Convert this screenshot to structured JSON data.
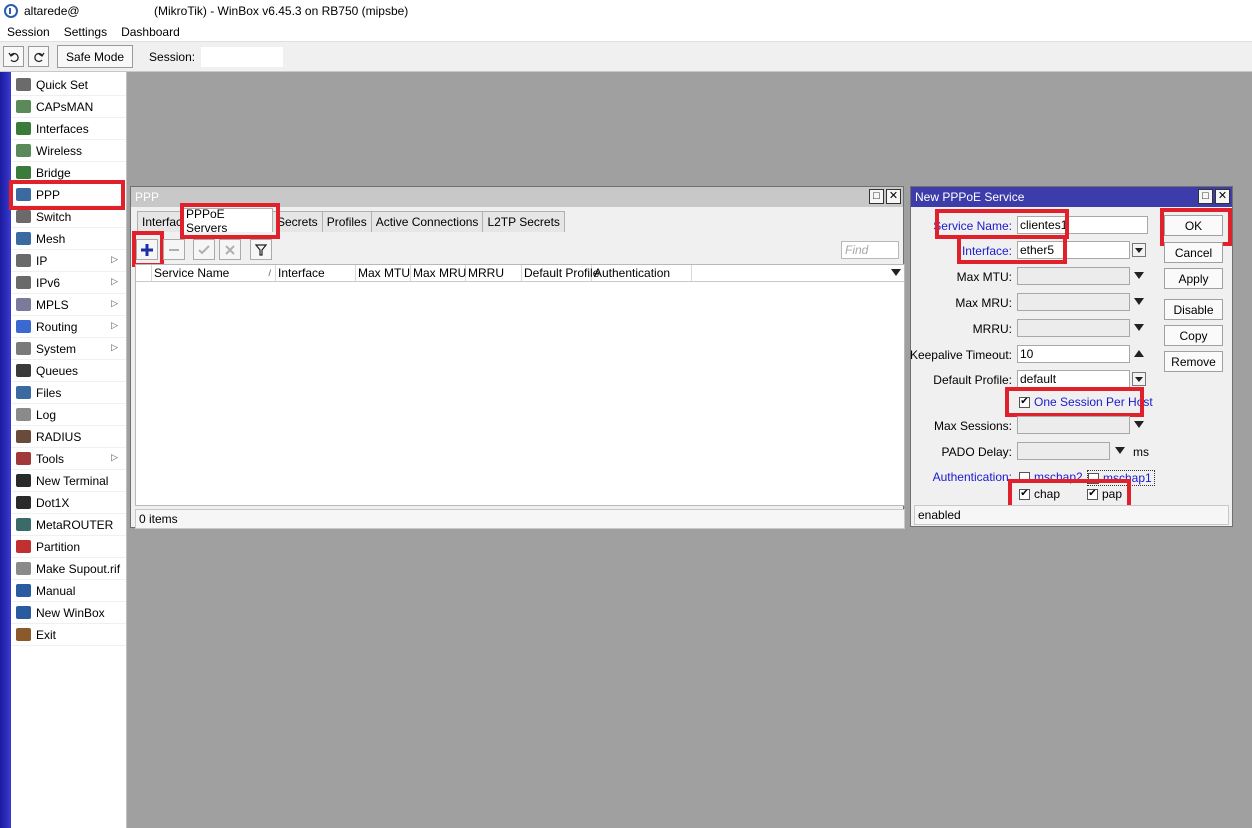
{
  "window": {
    "user": "altarede@",
    "title": "(MikroTik) - WinBox v6.45.3 on RB750 (mipsbe)"
  },
  "menubar": [
    "Session",
    "Settings",
    "Dashboard"
  ],
  "toolbar": {
    "undo_icon": "undo-icon",
    "redo_icon": "redo-icon",
    "safe_mode": "Safe Mode",
    "session_label": "Session:"
  },
  "sidebar": {
    "items": [
      {
        "label": "Quick Set",
        "icon": "wand-icon",
        "color": "#6b6b6b"
      },
      {
        "label": "CAPsMAN",
        "icon": "antenna-icon",
        "color": "#5a8a5a"
      },
      {
        "label": "Interfaces",
        "icon": "interfaces-icon",
        "color": "#3a7a3a"
      },
      {
        "label": "Wireless",
        "icon": "wireless-icon",
        "color": "#5a8a5a"
      },
      {
        "label": "Bridge",
        "icon": "bridge-icon",
        "color": "#3a7a3a"
      },
      {
        "label": "PPP",
        "icon": "ppp-icon",
        "color": "#3a6aa0"
      },
      {
        "label": "Switch",
        "icon": "switch-icon",
        "color": "#6a6a6a"
      },
      {
        "label": "Mesh",
        "icon": "mesh-icon",
        "color": "#3a6aa0"
      },
      {
        "label": "IP",
        "icon": "ip-icon",
        "color": "#6a6a6a",
        "submenu": true
      },
      {
        "label": "IPv6",
        "icon": "ipv6-icon",
        "color": "#6a6a6a",
        "submenu": true
      },
      {
        "label": "MPLS",
        "icon": "mpls-icon",
        "color": "#7a7a9a",
        "submenu": true
      },
      {
        "label": "Routing",
        "icon": "routing-icon",
        "color": "#3a6ad0",
        "submenu": true
      },
      {
        "label": "System",
        "icon": "gear-icon",
        "color": "#7a7a7a",
        "submenu": true
      },
      {
        "label": "Queues",
        "icon": "queues-icon",
        "color": "#3a3a3a"
      },
      {
        "label": "Files",
        "icon": "folder-icon",
        "color": "#3a6aa0"
      },
      {
        "label": "Log",
        "icon": "log-icon",
        "color": "#8a8a8a"
      },
      {
        "label": "RADIUS",
        "icon": "radius-icon",
        "color": "#6a4a3a"
      },
      {
        "label": "Tools",
        "icon": "tools-icon",
        "color": "#a03a3a",
        "submenu": true
      },
      {
        "label": "New Terminal",
        "icon": "terminal-icon",
        "color": "#2a2a2a"
      },
      {
        "label": "Dot1X",
        "icon": "dot1x-icon",
        "color": "#2a2a2a"
      },
      {
        "label": "MetaROUTER",
        "icon": "metarouter-icon",
        "color": "#3a6a6a"
      },
      {
        "label": "Partition",
        "icon": "partition-icon",
        "color": "#c03030"
      },
      {
        "label": "Make Supout.rif",
        "icon": "document-icon",
        "color": "#8a8a8a"
      },
      {
        "label": "Manual",
        "icon": "help-icon",
        "color": "#2a5aa0"
      },
      {
        "label": "New WinBox",
        "icon": "winbox-icon",
        "color": "#2a5aa0"
      },
      {
        "label": "Exit",
        "icon": "exit-icon",
        "color": "#8a5a2a"
      }
    ]
  },
  "ppp": {
    "title": "PPP",
    "tabs": [
      "Interface",
      "PPPoE Servers",
      "Secrets",
      "Profiles",
      "Active Connections",
      "L2TP Secrets"
    ],
    "selected_tab": "PPPoE Servers",
    "find_placeholder": "Find",
    "columns": [
      "Service Name",
      "Interface",
      "Max MTU",
      "Max MRU",
      "MRRU",
      "Default Profile",
      "Authentication"
    ],
    "status": "0 items"
  },
  "pppoe_dialog": {
    "title": "New PPPoE Service",
    "fields": {
      "service_name_label": "Service Name:",
      "service_name": "clientes1",
      "interface_label": "Interface:",
      "interface": "ether5",
      "max_mtu_label": "Max MTU:",
      "max_mru_label": "Max MRU:",
      "mrru_label": "MRRU:",
      "keepalive_label": "Keepalive Timeout:",
      "keepalive": "10",
      "default_profile_label": "Default Profile:",
      "default_profile": "default",
      "one_session_label": "One Session Per Host",
      "max_sessions_label": "Max Sessions:",
      "pado_delay_label": "PADO Delay:",
      "pado_unit": "ms",
      "auth_label": "Authentication:",
      "mschap2": "mschap2",
      "mschap1": "mschap1",
      "chap": "chap",
      "pap": "pap"
    },
    "checked": {
      "one_session": true,
      "mschap2": false,
      "mschap1": false,
      "chap": true,
      "pap": true
    },
    "buttons": [
      "OK",
      "Cancel",
      "Apply",
      "Disable",
      "Copy",
      "Remove"
    ],
    "status": "enabled"
  },
  "colors": {
    "highlight": "#e0202a",
    "title_active": "#3c3caa",
    "link_blue": "#1a1ad0"
  }
}
